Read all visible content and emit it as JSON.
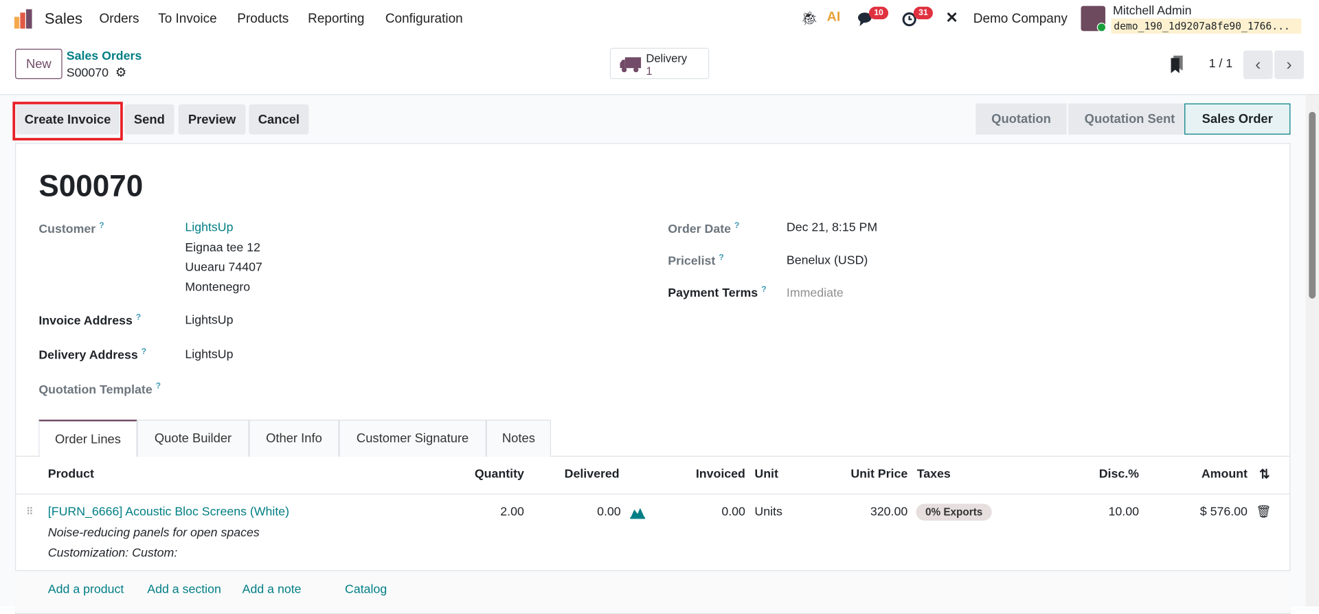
{
  "nav": {
    "app": "Sales",
    "menu": [
      "Orders",
      "To Invoice",
      "Products",
      "Reporting",
      "Configuration"
    ],
    "messages_count": "10",
    "activities_count": "31",
    "company": "Demo Company",
    "user": "Mitchell Admin",
    "database": "demo_190_1d9207a8fe90_1766..."
  },
  "control": {
    "new_label": "New",
    "breadcrumb_parent": "Sales Orders",
    "record": "S00070",
    "delivery_label": "Delivery",
    "delivery_count": "1",
    "pager": "1 / 1"
  },
  "actions": {
    "create_invoice": "Create Invoice",
    "send": "Send",
    "preview": "Preview",
    "cancel": "Cancel"
  },
  "statusbar": {
    "stages": [
      "Quotation",
      "Quotation Sent",
      "Sales Order"
    ],
    "active": "Sales Order"
  },
  "form": {
    "title": "S00070",
    "customer_label": "Customer",
    "customer": "LightsUp",
    "address": [
      "Eignaa tee 12",
      "Uuearu 74407",
      "Montenegro"
    ],
    "invoice_address_label": "Invoice Address",
    "invoice_address": "LightsUp",
    "delivery_address_label": "Delivery Address",
    "delivery_address": "LightsUp",
    "quotation_template_label": "Quotation Template",
    "order_date_label": "Order Date",
    "order_date": "Dec 21, 8:15 PM",
    "pricelist_label": "Pricelist",
    "pricelist": "Benelux (USD)",
    "payment_terms_label": "Payment Terms",
    "payment_terms_placeholder": "Immediate",
    "help": "?"
  },
  "tabs": [
    "Order Lines",
    "Quote Builder",
    "Other Info",
    "Customer Signature",
    "Notes"
  ],
  "table": {
    "headers": {
      "product": "Product",
      "quantity": "Quantity",
      "delivered": "Delivered",
      "invoiced": "Invoiced",
      "unit": "Unit",
      "unit_price": "Unit Price",
      "taxes": "Taxes",
      "disc": "Disc.%",
      "amount": "Amount"
    },
    "rows": [
      {
        "product": "[FURN_6666] Acoustic Bloc Screens (White)",
        "description": "Noise-reducing panels for open spaces",
        "customization": "Customization: Custom:",
        "quantity": "2.00",
        "delivered": "0.00",
        "invoiced": "0.00",
        "unit": "Units",
        "unit_price": "320.00",
        "tax": "0% Exports",
        "disc": "10.00",
        "amount": "$ 576.00"
      }
    ],
    "footer": {
      "add_product": "Add a product",
      "add_section": "Add a section",
      "add_note": "Add a note",
      "catalog": "Catalog"
    }
  }
}
